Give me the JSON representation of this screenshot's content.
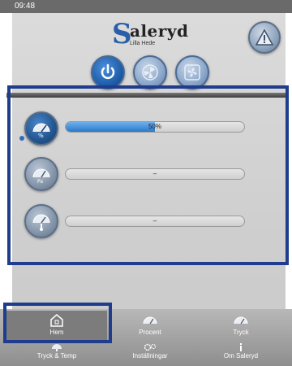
{
  "status_bar": {
    "time": "09:48"
  },
  "brand": {
    "initial": "S",
    "name": "aleryd",
    "tagline": "Lilla Hede"
  },
  "header_icons": {
    "warning": "warning-triangle-icon",
    "power": "power-icon",
    "fan_speed": "fan-speed-icon",
    "fan": "fan-icon"
  },
  "gauges": [
    {
      "icon": "percent-gauge-icon",
      "value_label": "50%",
      "fill": 0.5
    },
    {
      "icon": "pressure-gauge-icon",
      "value_label": "–"
    },
    {
      "icon": "temperature-gauge-icon",
      "value_label": "–"
    }
  ],
  "nav": [
    {
      "label": "Hem",
      "icon": "home-icon"
    },
    {
      "label": "Procent",
      "icon": "percent-gauge-icon"
    },
    {
      "label": "Tryck",
      "icon": "pressure-gauge-icon"
    },
    {
      "label": "Tryck & Temp",
      "icon": "pressure-temp-icon"
    },
    {
      "label": "Inställningar",
      "icon": "settings-gears-icon"
    },
    {
      "label": "Om Saleryd",
      "icon": "info-icon"
    }
  ],
  "colors": {
    "accent": "#2a79c8",
    "highlight": "#1f3d8c"
  }
}
